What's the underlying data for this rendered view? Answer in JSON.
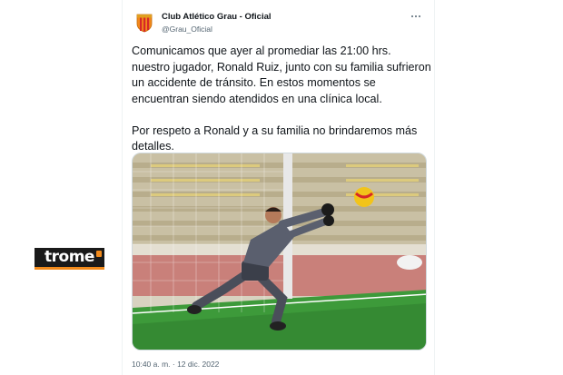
{
  "brand": {
    "logo_text": "trome",
    "accent_color": "#f28a1b"
  },
  "tweet": {
    "author_name": "Club Atlético Grau - Oficial",
    "author_handle": "@Grau_Oficial",
    "avatar_icon": "club-crest-icon",
    "more_icon": "more-options-icon",
    "text": "Comunicamos que ayer al promediar las 21:00 hrs. nuestro jugador, Ronald Ruiz, junto con su familia sufrieron un accidente de tránsito. En estos momentos se encuentran siendo atendidos en una clínica local.\n\nPor respeto a Ronald y a su familia no brindaremos más detalles.",
    "media_description_icon": "goalkeeper-photo",
    "timestamp": "10:40 a. m. · 12 dic. 2022"
  },
  "colors": {
    "text_primary": "#0f1419",
    "text_secondary": "#536471",
    "border": "#cfd9de",
    "crest_orange": "#f28a1b",
    "crest_red": "#d62828"
  }
}
